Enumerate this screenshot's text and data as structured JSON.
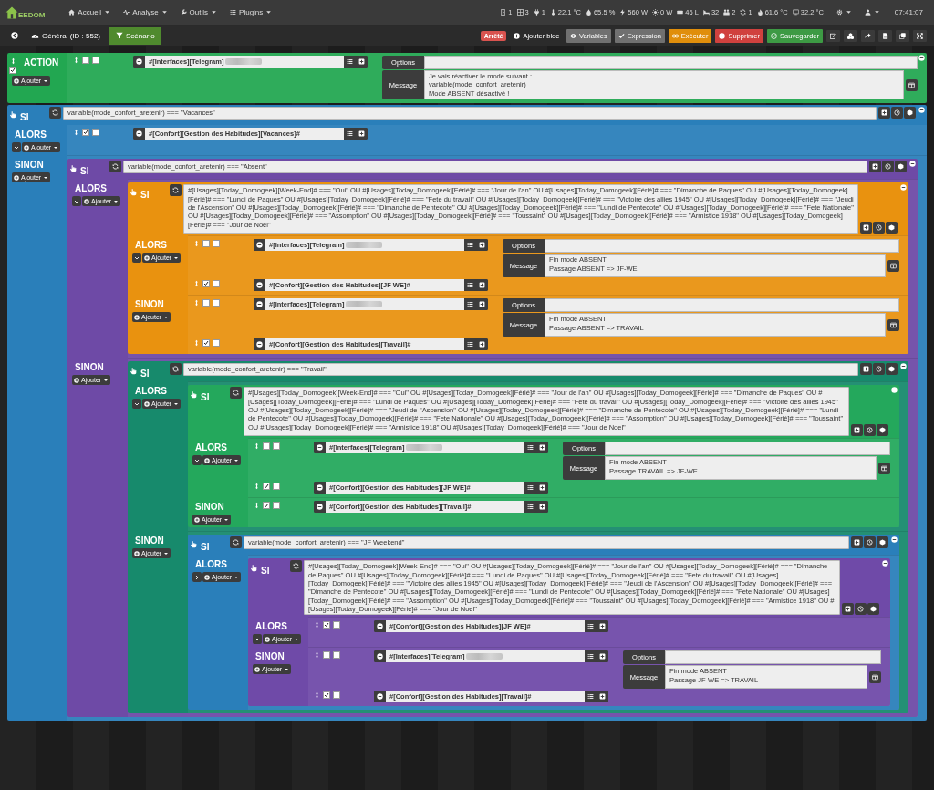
{
  "navbar": {
    "logo": "EEDOM",
    "menus": [
      "Accueil",
      "Analyse",
      "Outils",
      "Plugins"
    ],
    "status": [
      "1",
      "3",
      "1",
      "22.1 °C",
      "65.5 %",
      "560 W",
      "0 W",
      "46 L",
      "32",
      "2",
      "1",
      "61.6 °C",
      "32.2 °C"
    ],
    "time": "07:41:07"
  },
  "toolbar": {
    "title": "Général (ID : 552)",
    "tabs": [
      {
        "label": "Scénario",
        "selected": true
      }
    ],
    "state": {
      "label": "Arrêté",
      "kind": "stopped"
    },
    "buttons": [
      {
        "label": "Ajouter bloc",
        "kind": "plain"
      },
      {
        "label": "Variables",
        "kind": "grey"
      },
      {
        "label": "Expression",
        "kind": "grey"
      },
      {
        "label": "Exécuter",
        "kind": "orange"
      },
      {
        "label": "Supprimer",
        "kind": "red"
      },
      {
        "label": "Sauvegarder",
        "kind": "green"
      }
    ]
  },
  "blocks": [
    {
      "kind": "action",
      "label": "ACTION",
      "color": "#22a751",
      "enabled": true,
      "add": "Ajouter",
      "actions": [
        {
          "kind": "action",
          "expression": "#[Interfaces][Telegram]",
          "redacted": true,
          "enabled": false,
          "parallel": false,
          "options_label": "Options",
          "message_label": "Message",
          "message": "Je vais réactiver le mode suivant :\nvariable(mode_confort_aretenir)\nMode ABSENT désactivé !"
        }
      ]
    },
    {
      "kind": "if",
      "label": "SI",
      "color": "#2a7fba",
      "condition": "variable(mode_confort_aretenir) === \"Vacances\"",
      "then_label": "ALORS",
      "then_expanded": true,
      "then_add": "Ajouter",
      "else_label": "SINON",
      "else_add": "Ajouter",
      "then": [
        {
          "kind": "action",
          "expression": "#[Confort][Gestion des Habitudes][Vacances]#",
          "enabled": true,
          "parallel": false
        }
      ],
      "else": [
        {
          "kind": "if",
          "label": "SI",
          "color": "#6e4aa6",
          "condition": "variable(mode_confort_aretenir) === \"Absent\"",
          "then_label": "ALORS",
          "then_expanded": true,
          "then_add": "Ajouter",
          "else_label": "SINON",
          "else_add": "Ajouter",
          "then": [
            {
              "kind": "if",
              "label": "SI",
              "color": "#e9920f",
              "condition": "#[Usages][Today_Domogeek][Week-End]# === \"Oui\" OU #[Usages][Today_Domogeek][Férié]# === \"Jour de l'an\" OU #[Usages][Today_Domogeek][Férié]# === \"Dimanche de Paques\" OU #[Usages][Today_Domogeek][Férié]# === \"Lundi de Paques\" OU #[Usages][Today_Domogeek][Férié]# === \"Fete du travail\" OU #[Usages][Today_Domogeek][Férié]# === \"Victoire des allies 1945\" OU #[Usages][Today_Domogeek][Férié]# === \"Jeudi de l'Ascension\" OU #[Usages][Today_Domogeek][Férié]# === \"Dimanche de Pentecote\" OU #[Usages][Today_Domogeek][Férié]# === \"Lundi de Pentecote\" OU #[Usages][Today_Domogeek][Férié]# === \"Fete Nationale\" OU #[Usages][Today_Domogeek][Férié]# === \"Assomption\" OU #[Usages][Today_Domogeek][Férié]# === \"Toussaint\" OU #[Usages][Today_Domogeek][Férié]# === \"Armistice 1918\" OU #[Usages][Today_Domogeek][Férié]# === \"Jour de Noel\"",
              "then_label": "ALORS",
              "then_expanded": true,
              "then_add": "Ajouter",
              "else_label": "SINON",
              "else_add": "Ajouter",
              "then": [
                {
                  "kind": "action",
                  "expression": "#[Interfaces][Telegram]",
                  "redacted": true,
                  "enabled": false,
                  "parallel": false,
                  "options_label": "Options",
                  "message_label": "Message",
                  "message": "Fin mode ABSENT\nPassage ABSENT => JF-WE"
                },
                {
                  "kind": "action",
                  "expression": "#[Confort][Gestion des Habitudes][JF WE]#",
                  "enabled": true,
                  "parallel": false
                }
              ],
              "else": [
                {
                  "kind": "action",
                  "expression": "#[Interfaces][Telegram]",
                  "redacted": true,
                  "enabled": false,
                  "parallel": false,
                  "options_label": "Options",
                  "message_label": "Message",
                  "message": "Fin mode ABSENT\nPassage ABSENT => TRAVAIL"
                },
                {
                  "kind": "action",
                  "expression": "#[Confort][Gestion des Habitudes][Travail]#",
                  "enabled": true,
                  "parallel": false
                }
              ]
            }
          ],
          "else": [
            {
              "kind": "if",
              "label": "SI",
              "color": "#178a6c",
              "condition": "variable(mode_confort_aretenir) === \"Travail\"",
              "then_label": "ALORS",
              "then_expanded": true,
              "then_add": "Ajouter",
              "else_label": "SINON",
              "else_add": "Ajouter",
              "then": [
                {
                  "kind": "if",
                  "label": "SI",
                  "color": "#24a85c",
                  "condition": "#[Usages][Today_Domogeek][Week-End]# === \"Oui\" OU #[Usages][Today_Domogeek][Férié]# === \"Jour de l'an\" OU #[Usages][Today_Domogeek][Férié]# === \"Dimanche de Paques\" OU #[Usages][Today_Domogeek][Férié]# === \"Lundi de Paques\" OU #[Usages][Today_Domogeek][Férié]# === \"Fete du travail\" OU #[Usages][Today_Domogeek][Férié]# === \"Victoire des allies 1945\" OU #[Usages][Today_Domogeek][Férié]# === \"Jeudi de l'Ascension\" OU #[Usages][Today_Domogeek][Férié]# === \"Dimanche de Pentecote\" OU #[Usages][Today_Domogeek][Férié]# === \"Lundi de Pentecote\" OU #[Usages][Today_Domogeek][Férié]# === \"Fete Nationale\" OU #[Usages][Today_Domogeek][Férié]# === \"Assomption\" OU #[Usages][Today_Domogeek][Férié]# === \"Toussaint\" OU #[Usages][Today_Domogeek][Férié]# === \"Armistice 1918\" OU #[Usages][Today_Domogeek][Férié]# === \"Jour de Noel\"",
                  "then_label": "ALORS",
                  "then_expanded": true,
                  "then_add": "Ajouter",
                  "else_label": "SINON",
                  "else_add": "Ajouter",
                  "then": [
                    {
                      "kind": "action",
                      "expression": "#[Interfaces][Telegram]",
                      "redacted": true,
                      "enabled": false,
                      "parallel": false,
                      "options_label": "Options",
                      "message_label": "Message",
                      "message": "Fin mode ABSENT\nPassage TRAVAIL => JF-WE"
                    },
                    {
                      "kind": "action",
                      "expression": "#[Confort][Gestion des Habitudes][JF WE]#",
                      "enabled": true,
                      "parallel": false
                    }
                  ],
                  "else": [
                    {
                      "kind": "action",
                      "expression": "#[Confort][Gestion des Habitudes][Travail]#",
                      "enabled": true,
                      "parallel": false
                    }
                  ]
                }
              ],
              "else": [
                {
                  "kind": "if",
                  "label": "SI",
                  "color": "#2a7fba",
                  "condition": "variable(mode_confort_aretenir) === \"JF Weekend\"",
                  "then_label": "ALORS",
                  "then_expanded": false,
                  "then_add": "Ajouter",
                  "then": [
                    {
                      "kind": "if",
                      "label": "SI",
                      "color": "#6f4aa8",
                      "condition": "#[Usages][Today_Domogeek][Week-End]# === \"Oui\" OU #[Usages][Today_Domogeek][Férié]# === \"Jour de l'an\" OU #[Usages][Today_Domogeek][Férié]# === \"Dimanche de Paques\" OU #[Usages][Today_Domogeek][Férié]# === \"Lundi de Paques\" OU #[Usages][Today_Domogeek][Férié]# === \"Fete du travail\" OU #[Usages][Today_Domogeek][Férié]# === \"Victoire des allies 1945\" OU #[Usages][Today_Domogeek][Férié]# === \"Jeudi de l'Ascension\" OU #[Usages][Today_Domogeek][Férié]# === \"Dimanche de Pentecote\" OU #[Usages][Today_Domogeek][Férié]# === \"Lundi de Pentecote\" OU #[Usages][Today_Domogeek][Férié]# === \"Fete Nationale\" OU #[Usages][Today_Domogeek][Férié]# === \"Assomption\" OU #[Usages][Today_Domogeek][Férié]# === \"Toussaint\" OU #[Usages][Today_Domogeek][Férié]# === \"Armistice 1918\" OU #[Usages][Today_Domogeek][Férié]# === \"Jour de Noel\"",
                      "then_label": "ALORS",
                      "then_expanded": true,
                      "then_add": "Ajouter",
                      "else_label": "SINON",
                      "else_add": "Ajouter",
                      "then": [
                        {
                          "kind": "action",
                          "expression": "#[Confort][Gestion des Habitudes][JF WE]#",
                          "enabled": true,
                          "parallel": false
                        }
                      ],
                      "else": [
                        {
                          "kind": "action",
                          "expression": "#[Interfaces][Telegram]",
                          "redacted": true,
                          "enabled": false,
                          "parallel": false,
                          "options_label": "Options",
                          "message_label": "Message",
                          "message": "Fin mode ABSENT\nPassage JF-WE => TRAVAIL"
                        },
                        {
                          "kind": "action",
                          "expression": "#[Confort][Gestion des Habitudes][Travail]#",
                          "enabled": true,
                          "parallel": false
                        }
                      ]
                    }
                  ]
                }
              ]
            }
          ]
        }
      ]
    }
  ]
}
